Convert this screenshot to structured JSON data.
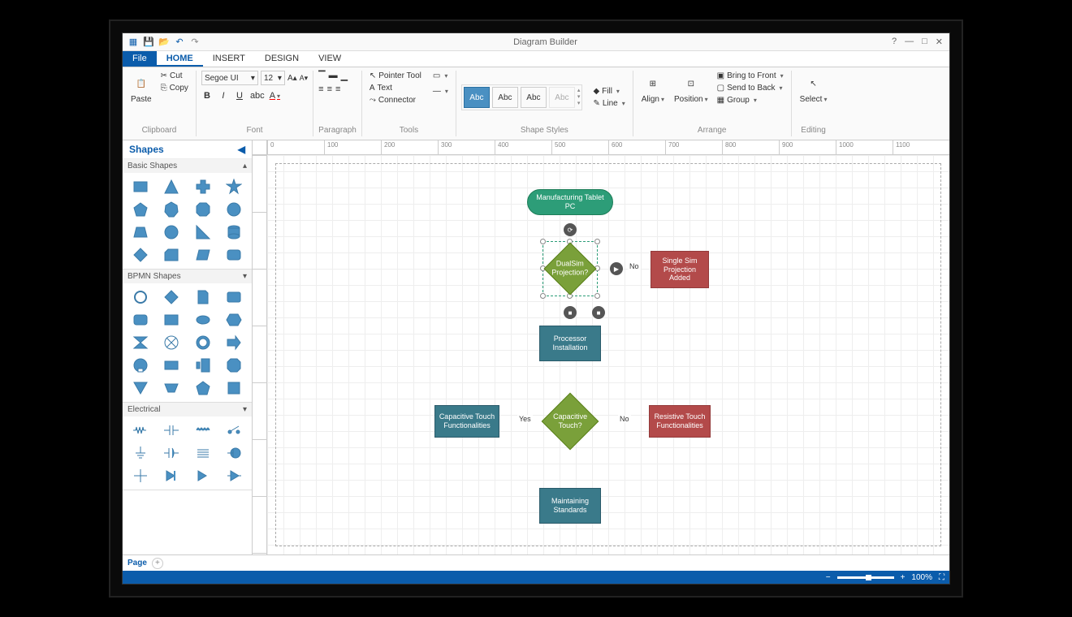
{
  "app": {
    "title": "Diagram Builder"
  },
  "tabs": {
    "file": "File",
    "home": "HOME",
    "insert": "INSERT",
    "design": "DESIGN",
    "view": "VIEW"
  },
  "ribbon": {
    "clipboard": {
      "label": "Clipboard",
      "paste": "Paste",
      "cut": "Cut",
      "copy": "Copy"
    },
    "font": {
      "label": "Font",
      "family": "Segoe UI",
      "size": "12"
    },
    "paragraph": {
      "label": "Paragraph"
    },
    "tools": {
      "label": "Tools",
      "pointer": "Pointer Tool",
      "text": "Text",
      "connector": "Connector"
    },
    "styles": {
      "label": "Shape Styles",
      "abc": "Abc",
      "fill": "Fill",
      "line": "Line"
    },
    "arrange": {
      "label": "Arrange",
      "align": "Align",
      "position": "Position",
      "bringfront": "Bring to Front",
      "sendback": "Send to Back",
      "group": "Group"
    },
    "editing": {
      "label": "Editing",
      "select": "Select"
    }
  },
  "shapes": {
    "title": "Shapes",
    "sections": {
      "basic": "Basic Shapes",
      "bpmn": "BPMN Shapes",
      "electrical": "Electrical"
    }
  },
  "diagram": {
    "start": "Manufacturing Tablet PC",
    "dec1": "DualSim Projection?",
    "box1": "Single Sim Projection Added",
    "proc1": "Processor Installation",
    "dec2": "Capacitive Touch?",
    "boxL": "Capacitive Touch Functionalities",
    "boxR": "Resistive Touch Functionalities",
    "proc2": "Maintaining Standards",
    "yes": "Yes",
    "no": "No"
  },
  "pagetabs": {
    "page": "Page"
  },
  "status": {
    "zoom": "100%"
  }
}
